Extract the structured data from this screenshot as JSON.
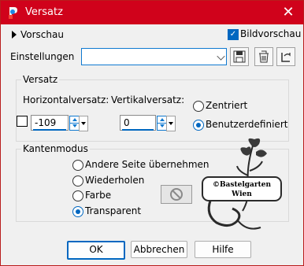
{
  "window": {
    "title": "Versatz",
    "close_glyph": "✕"
  },
  "preview": {
    "label": "Vorschau",
    "bild_label": "Bildvorschau",
    "bild_checked": true
  },
  "settings": {
    "label": "Einstellungen",
    "value": ""
  },
  "versatz": {
    "title": "Versatz",
    "horizontal_label": "Horizontalversatz:",
    "horizontal_value": "-109",
    "vertikal_label": "Vertikalversatz:",
    "vertikal_value": "0",
    "options": [
      "Zentriert",
      "Benutzerdefiniert"
    ],
    "selected": "Benutzerdefiniert"
  },
  "kanten": {
    "title": "Kantenmodus",
    "options": [
      "Andere Seite übernehmen",
      "Wiederholen",
      "Farbe",
      "Transparent"
    ],
    "selected": "Transparent"
  },
  "watermark": {
    "line1": "©Bastelgarten",
    "line2": "Wien"
  },
  "buttons": {
    "ok": "OK",
    "cancel": "Abbrechen",
    "help": "Hilfe"
  },
  "icons": [
    "save-icon",
    "delete-icon",
    "reset-icon",
    "no-color-icon"
  ],
  "colors": {
    "titlebar": "#d0021b",
    "accent": "#0067c0"
  }
}
